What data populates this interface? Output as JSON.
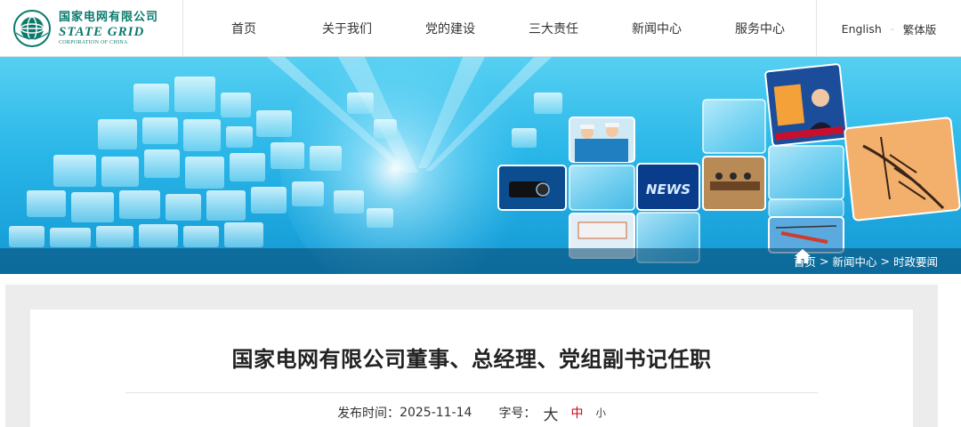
{
  "header": {
    "logo": {
      "cn": "国家电网有限公司",
      "en": "STATE GRID",
      "sub": "CORPORATION OF CHINA"
    },
    "nav": [
      "首页",
      "关于我们",
      "党的建设",
      "三大责任",
      "新闻中心",
      "服务中心"
    ],
    "lang": {
      "english": "English",
      "traditional": "繁体版"
    }
  },
  "banner": {
    "tile_labels": {
      "news": "NEWS"
    },
    "breadcrumb": [
      "首页",
      "新闻中心",
      "时政要闻"
    ],
    "breadcrumb_sep": ">"
  },
  "article": {
    "title": "国家电网有限公司董事、总经理、党组副书记任职",
    "publish_label": "发布时间：",
    "publish_date": "2025-11-14",
    "font_size_label": "字号：",
    "font_sizes": [
      "大",
      "中",
      "小"
    ]
  },
  "colors": {
    "brand": "#0b7a6d",
    "banner_blue": "#29b6e8",
    "active_font_size": "#d0021b"
  }
}
